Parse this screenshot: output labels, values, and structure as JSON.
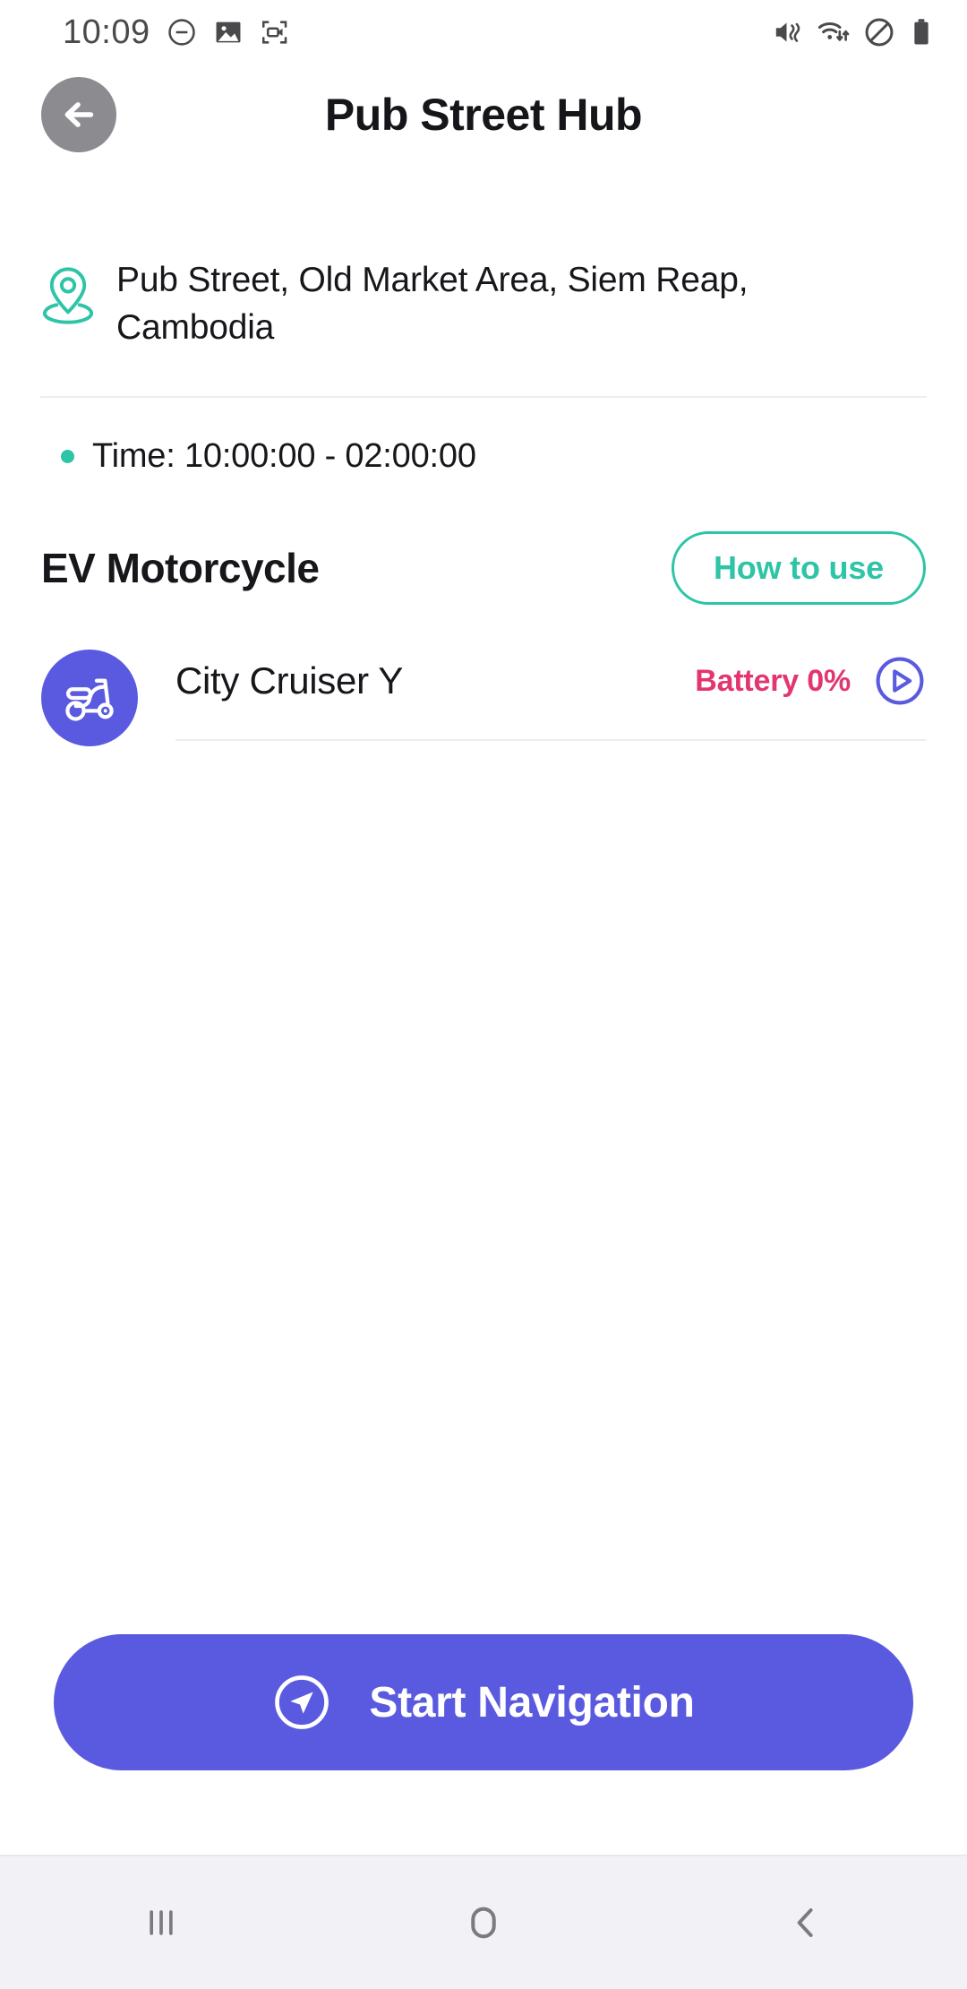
{
  "status_bar": {
    "time": "10:09",
    "left_icons": [
      "dnd-icon",
      "image-icon",
      "screen-recorder-icon"
    ],
    "right_icons": [
      "vibrate-mute-icon",
      "wifi-icon",
      "blocked-icon",
      "battery-icon"
    ]
  },
  "header": {
    "back_icon": "arrow-left-icon",
    "title": "Pub Street Hub"
  },
  "location": {
    "pin_icon": "map-pin-icon",
    "address": "Pub Street, Old Market Area, Siem Reap, Cambodia",
    "time_label": "Time: 10:00:00 - 02:00:00"
  },
  "section": {
    "title": "EV Motorcycle",
    "how_to_use_label": "How to use"
  },
  "vehicles": [
    {
      "icon": "scooter-icon",
      "name": "City Cruiser Y",
      "battery": "Battery 0%",
      "action_icon": "play-circle-icon"
    }
  ],
  "cta": {
    "icon": "navigation-arrow-icon",
    "label": "Start Navigation"
  },
  "nav_bar": {
    "recents_label": "recents-icon",
    "home_label": "home-icon",
    "back_label": "back-icon"
  },
  "colors": {
    "accent_teal": "#2ec4a6",
    "accent_purple": "#5a5ae0",
    "battery_pink": "#e2366f",
    "text_dark": "#17171b",
    "divider": "#ededf1",
    "navbar_bg": "#f2f1f5",
    "back_btn_gray": "#8b8b90"
  }
}
